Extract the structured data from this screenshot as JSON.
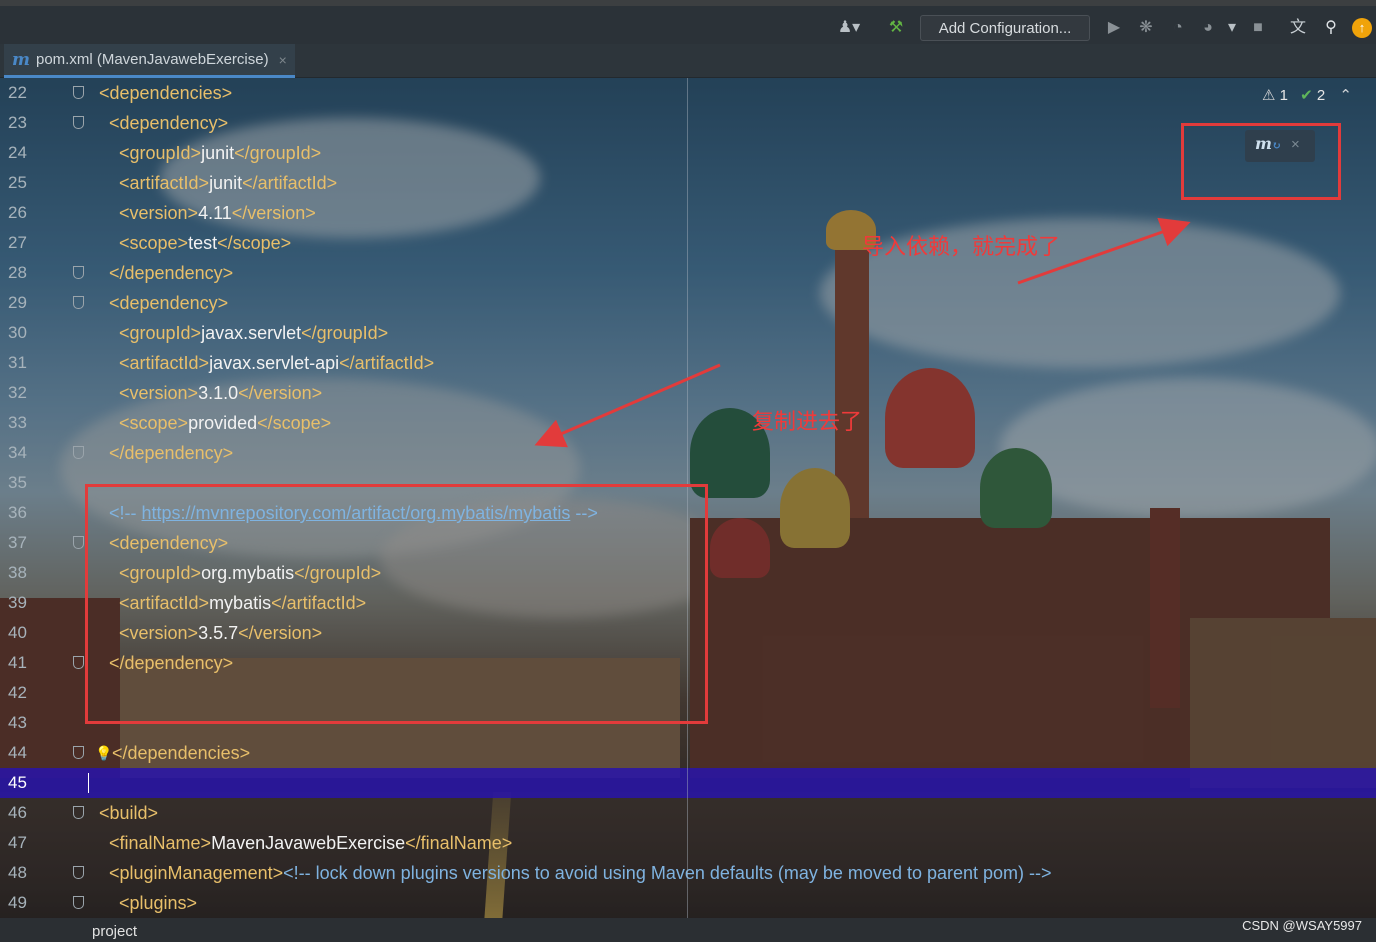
{
  "toolbar": {
    "add_config_label": "Add Configuration...",
    "icons": [
      "user-dropdown-icon",
      "hammer-build-icon",
      "run-icon",
      "debug-icon",
      "coverage-icon",
      "profile-icon",
      "more-dropdown-icon",
      "stop-icon",
      "translate-icon",
      "search-icon",
      "update-icon"
    ]
  },
  "tab": {
    "label": "pom.xml (MavenJavawebExercise)",
    "icon": "maven-m-icon",
    "close": "×"
  },
  "inspections": {
    "warnings": "1",
    "checks": "2"
  },
  "editor": {
    "lines": [
      {
        "n": "22",
        "indent": 0,
        "parts": [
          [
            "tag",
            "<dependencies>"
          ]
        ]
      },
      {
        "n": "23",
        "indent": 1,
        "parts": [
          [
            "tag",
            "<dependency>"
          ]
        ]
      },
      {
        "n": "24",
        "indent": 2,
        "parts": [
          [
            "tag",
            "<groupId>"
          ],
          [
            "txt",
            "junit"
          ],
          [
            "tag",
            "</groupId>"
          ]
        ]
      },
      {
        "n": "25",
        "indent": 2,
        "parts": [
          [
            "tag",
            "<artifactId>"
          ],
          [
            "txt",
            "junit"
          ],
          [
            "tag",
            "</artifactId>"
          ]
        ]
      },
      {
        "n": "26",
        "indent": 2,
        "parts": [
          [
            "tag",
            "<version>"
          ],
          [
            "txt",
            "4.11"
          ],
          [
            "tag",
            "</version>"
          ]
        ]
      },
      {
        "n": "27",
        "indent": 2,
        "parts": [
          [
            "tag",
            "<scope>"
          ],
          [
            "txt",
            "test"
          ],
          [
            "tag",
            "</scope>"
          ]
        ]
      },
      {
        "n": "28",
        "indent": 1,
        "parts": [
          [
            "tag",
            "</dependency>"
          ]
        ]
      },
      {
        "n": "29",
        "indent": 1,
        "parts": [
          [
            "tag",
            "<dependency>"
          ]
        ]
      },
      {
        "n": "30",
        "indent": 2,
        "parts": [
          [
            "tag",
            "<groupId>"
          ],
          [
            "txt",
            "javax.servlet"
          ],
          [
            "tag",
            "</groupId>"
          ]
        ]
      },
      {
        "n": "31",
        "indent": 2,
        "parts": [
          [
            "tag",
            "<artifactId>"
          ],
          [
            "txt",
            "javax.servlet-api"
          ],
          [
            "tag",
            "</artifactId>"
          ]
        ]
      },
      {
        "n": "32",
        "indent": 2,
        "parts": [
          [
            "tag",
            "<version>"
          ],
          [
            "txt",
            "3.1.0"
          ],
          [
            "tag",
            "</version>"
          ]
        ]
      },
      {
        "n": "33",
        "indent": 2,
        "parts": [
          [
            "tag",
            "<scope>"
          ],
          [
            "txt",
            "provided"
          ],
          [
            "tag",
            "</scope>"
          ]
        ]
      },
      {
        "n": "34",
        "indent": 1,
        "parts": [
          [
            "tag",
            "</dependency>"
          ]
        ]
      },
      {
        "n": "35",
        "indent": 0,
        "parts": []
      },
      {
        "n": "36",
        "indent": 1,
        "parts": [
          [
            "cmt",
            "<!-- "
          ],
          [
            "url",
            "https://mvnrepository.com/artifact/org.mybatis/mybatis"
          ],
          [
            "cmt",
            " -->"
          ]
        ]
      },
      {
        "n": "37",
        "indent": 1,
        "parts": [
          [
            "tag",
            "<dependency>"
          ]
        ]
      },
      {
        "n": "38",
        "indent": 2,
        "parts": [
          [
            "tag",
            "<groupId>"
          ],
          [
            "txt",
            "org.mybatis"
          ],
          [
            "tag",
            "</groupId>"
          ]
        ]
      },
      {
        "n": "39",
        "indent": 2,
        "parts": [
          [
            "tag",
            "<artifactId>"
          ],
          [
            "txt",
            "mybatis"
          ],
          [
            "tag",
            "</artifactId>"
          ]
        ]
      },
      {
        "n": "40",
        "indent": 2,
        "parts": [
          [
            "tag",
            "<version>"
          ],
          [
            "txt",
            "3.5.7"
          ],
          [
            "tag",
            "</version>"
          ]
        ]
      },
      {
        "n": "41",
        "indent": 1,
        "parts": [
          [
            "tag",
            "</dependency>"
          ]
        ]
      },
      {
        "n": "42",
        "indent": 0,
        "parts": []
      },
      {
        "n": "43",
        "indent": 0,
        "parts": []
      },
      {
        "n": "44",
        "indent": 0,
        "parts": [
          [
            "tag",
            "</dependencies>"
          ]
        ]
      },
      {
        "n": "45",
        "indent": 0,
        "parts": []
      },
      {
        "n": "46",
        "indent": 0,
        "parts": [
          [
            "tag",
            "<build>"
          ]
        ]
      },
      {
        "n": "47",
        "indent": 1,
        "parts": [
          [
            "tag",
            "<finalName>"
          ],
          [
            "txt",
            "MavenJavawebExercise"
          ],
          [
            "tag",
            "</finalName>"
          ]
        ]
      },
      {
        "n": "48",
        "indent": 1,
        "parts": [
          [
            "tag",
            "<pluginManagement>"
          ],
          [
            "cmt",
            "<!-- lock down plugins versions to avoid using Maven defaults (may be moved to parent pom) -->"
          ]
        ]
      },
      {
        "n": "49",
        "indent": 2,
        "parts": [
          [
            "tag",
            "<plugins>"
          ]
        ]
      }
    ],
    "current_line": "45"
  },
  "annotations": {
    "imported_text": "导入依赖，就完成了",
    "copied_text": "复制进去了"
  },
  "maven_popup": {
    "icon": "maven-reload-icon",
    "close": "×"
  },
  "statusbar": {
    "breadcrumb": "project",
    "watermark": "CSDN @WSAY5997"
  },
  "colors": {
    "tag": "#e8bf6a",
    "text": "#f2f2f2",
    "comment": "#7fb3e0",
    "current_line": "#2814aa",
    "annotation": "#e23b3b",
    "accent": "#4a88c7"
  }
}
